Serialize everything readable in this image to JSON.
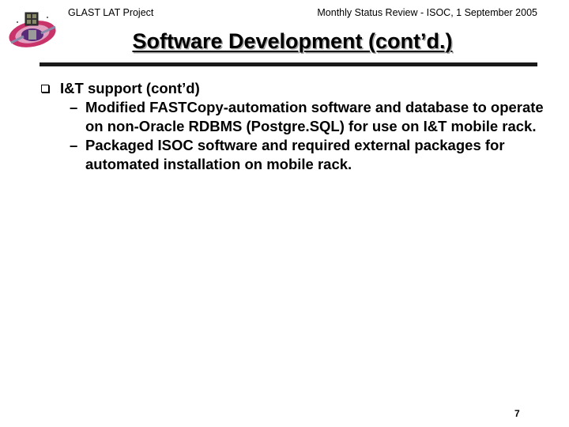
{
  "header": {
    "project": "GLAST LAT Project",
    "review": "Monthly Status Review - ISOC, 1 September 2005"
  },
  "slide": {
    "title": "Software Development (cont’d.)",
    "bullets": [
      {
        "text": "I&T support (cont’d)",
        "subitems": [
          {
            "dash": "–",
            "text": "Modified FASTCopy-automation software and database to operate on non-Oracle RDBMS (Postgre.SQL) for use on I&T mobile rack."
          },
          {
            "dash": "–",
            "text": "Packaged ISOC software and required external packages for automated installation on mobile rack."
          }
        ]
      }
    ]
  },
  "footer": {
    "page_number": "7"
  },
  "colors": {
    "rule": "#1a1a1a",
    "title_shadow": "#a8a8a8",
    "logo_ring": "#c8346a",
    "logo_core": "#5a2a7a"
  },
  "icons": {
    "logo": "glast-satellite-logo",
    "bullet": "square-bullet-icon"
  }
}
